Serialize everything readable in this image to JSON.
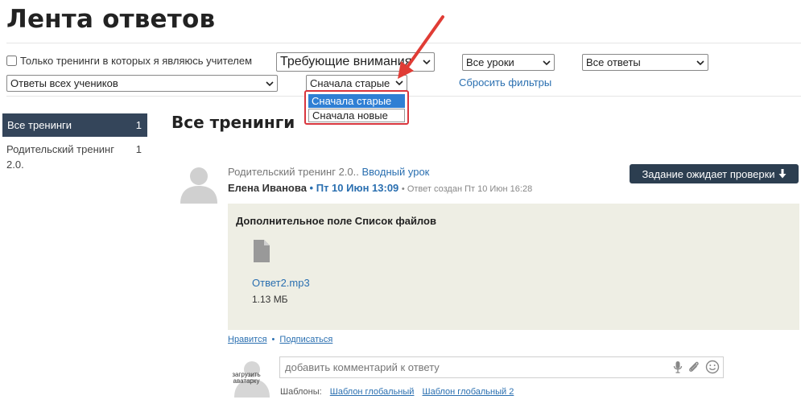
{
  "page": {
    "title": "Лента ответов"
  },
  "filters": {
    "only_teacher_checkbox_label": "Только тренинги в которых я являюсь учителем",
    "attention_select": "Требующие внимания",
    "lessons_select": "Все уроки",
    "answers_select": "Все ответы",
    "students_select": "Ответы всех учеников",
    "sort_select": "Сначала старые",
    "reset_link": "Сбросить фильтры",
    "sort_options": [
      "Сначала старые",
      "Сначала новые"
    ]
  },
  "sidebar": {
    "items": [
      {
        "label": "Все тренинги",
        "count": "1"
      },
      {
        "label": "Родительский тренинг 2.0.",
        "count": "1"
      }
    ]
  },
  "main": {
    "section_title": "Все тренинги",
    "answer": {
      "training": "Родительский тренинг 2.0..",
      "lesson": "Вводный урок",
      "author": "Елена Иванова",
      "sep": "•",
      "date": "Пт 10 Июн 13:09",
      "created": "• Ответ создан Пт 10 Июн 16:28",
      "status_button": "Задание ожидает проверки",
      "field_title": "Дополнительное поле Список файлов",
      "file_name": "Ответ2.mp3",
      "file_size": "1.13 МБ",
      "like": "Нравится",
      "subscribe": "Подписаться",
      "dot": "•"
    },
    "comment": {
      "placeholder": "добавить комментарий к ответу",
      "upload_avatar": "загрузить аватарку",
      "templates_label": "Шаблоны:",
      "templates": [
        "Шаблон глобальный",
        "Шаблон глобальный 2"
      ]
    }
  },
  "colors": {
    "sidebar_active_bg": "#34455a",
    "link": "#2a6fb0",
    "status_button_bg": "#2c3e50",
    "answer_box_bg": "#eeeee4",
    "highlight": "#d9363e",
    "selected_option": "#2f7fd4"
  }
}
